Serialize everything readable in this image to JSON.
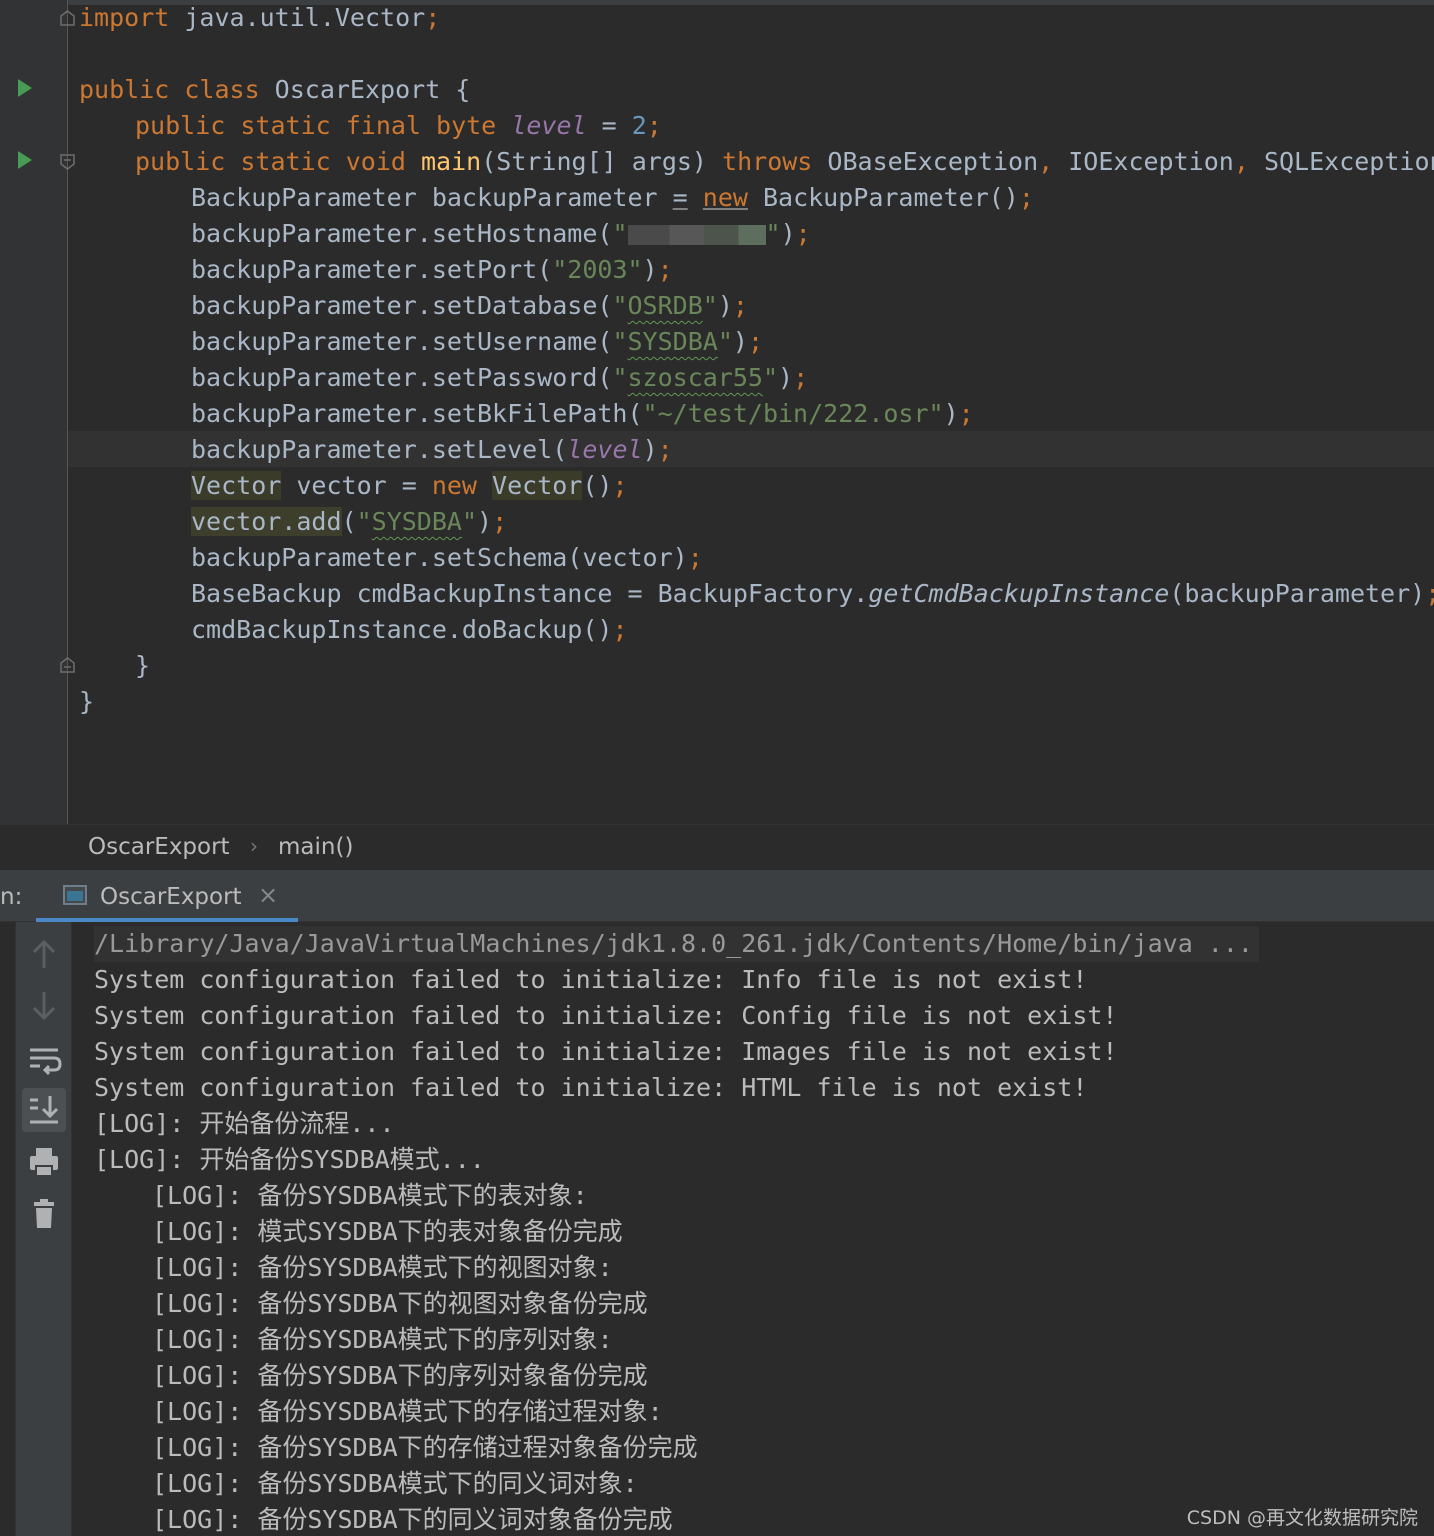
{
  "editor": {
    "lines": {
      "l1_kw": "import",
      "l1_rest": " java.util.Vector",
      "l1_semi": ";",
      "l3_kw": "public class",
      "l3_rest": " OscarExport {",
      "l4_kw": "public static final byte",
      "l4_fld": "level",
      "l4_eq": " = ",
      "l4_num": "2",
      "l4_semi": ";",
      "l5_kw": "public static void",
      "l5_fn": "main",
      "l5_args": "(String[] args) ",
      "l5_throws": "throws",
      "l5_exc1": " OBaseException",
      "l5_c1": ",",
      "l5_exc2": " IOException",
      "l5_c2": ",",
      "l5_exc3": " SQLException {",
      "l6_pre": "BackupParameter backupParameter ",
      "l6_eq": "=",
      "l6_new": "new",
      "l6_post": " BackupParameter()",
      "l6_semi": ";",
      "l7_pre": "backupParameter.setHostname(",
      "l7_q1": "\"",
      "l7_q2": "\"",
      "l7_post": ")",
      "l7_semi": ";",
      "l8_pre": "backupParameter.setPort(",
      "l8_str": "\"2003\"",
      "l8_post": ")",
      "l8_semi": ";",
      "l9_pre": "backupParameter.setDatabase(",
      "l9_q1": "\"",
      "l9_val": "OSRDB",
      "l9_q2": "\"",
      "l9_post": ")",
      "l9_semi": ";",
      "l10_pre": "backupParameter.setUsername(",
      "l10_q1": "\"",
      "l10_val": "SYSDBA",
      "l10_q2": "\"",
      "l10_post": ")",
      "l10_semi": ";",
      "l11_pre": "backupParameter.setPassword(",
      "l11_q1": "\"",
      "l11_val": "szoscar55",
      "l11_q2": "\"",
      "l11_post": ")",
      "l11_semi": ";",
      "l12_pre": "backupParameter.setBkFilePath(",
      "l12_str": "\"~/test/bin/222.osr\"",
      "l12_post": ")",
      "l12_semi": ";",
      "l13_pre": "backupParameter.setLevel(",
      "l13_fld": "level",
      "l13_post": ")",
      "l13_semi": ";",
      "l14_t1": "Vector",
      "l14_mid": " vector = ",
      "l14_new": "new",
      "l14_t2": "Vector",
      "l14_post": "()",
      "l14_semi": ";",
      "l15_pre": "vector.add",
      "l15_open": "(",
      "l15_q1": "\"",
      "l15_val": "SYSDBA",
      "l15_q2": "\"",
      "l15_post": ")",
      "l15_semi": ";",
      "l16_pre": "backupParameter.setSchema(vector)",
      "l16_semi": ";",
      "l17_pre": "BaseBackup cmdBackupInstance = BackupFactory.",
      "l17_it": "getCmdBackupInstance",
      "l17_post": "(backupParameter)",
      "l17_semi": ";",
      "l18_pre": "cmdBackupInstance.doBackup()",
      "l18_semi": ";",
      "l19": "}",
      "l20": "}"
    }
  },
  "breadcrumb": {
    "class_name": "OscarExport",
    "separator": "›",
    "method": "main()"
  },
  "run_window": {
    "prefix": "n:",
    "tab_label": "OscarExport",
    "tab_close": "×"
  },
  "console": {
    "toolbar_icons": [
      "up-arrow-icon",
      "down-arrow-icon",
      "soft-wrap-icon",
      "scroll-to-end-icon",
      "print-icon",
      "trash-icon"
    ],
    "lines": [
      "/Library/Java/JavaVirtualMachines/jdk1.8.0_261.jdk/Contents/Home/bin/java ...",
      "System configuration failed to initialize: Info file is not exist!",
      "System configuration failed to initialize: Config file is not exist!",
      "System configuration failed to initialize: Images file is not exist!",
      "System configuration failed to initialize: HTML file is not exist!",
      "[LOG]: 开始备份流程...",
      "[LOG]: 开始备份SYSDBA模式...",
      "[LOG]: 备份SYSDBA模式下的表对象:",
      "[LOG]: 模式SYSDBA下的表对象备份完成",
      "[LOG]: 备份SYSDBA模式下的视图对象:",
      "[LOG]: 备份SYSDBA下的视图对象备份完成",
      "[LOG]: 备份SYSDBA模式下的序列对象:",
      "[LOG]: 备份SYSDBA下的序列对象备份完成",
      "[LOG]: 备份SYSDBA模式下的存储过程对象:",
      "[LOG]: 备份SYSDBA下的存储过程对象备份完成",
      "[LOG]: 备份SYSDBA模式下的同义词对象:",
      "[LOG]: 备份SYSDBA下的同义词对象备份完成"
    ]
  },
  "watermark": "CSDN @再文化数据研究院",
  "colors": {
    "keyword": "#cc7832",
    "string": "#6a8759",
    "number": "#6897bb",
    "field": "#9876aa",
    "method_decl": "#ffc66d",
    "run_marker": "#499c54"
  }
}
